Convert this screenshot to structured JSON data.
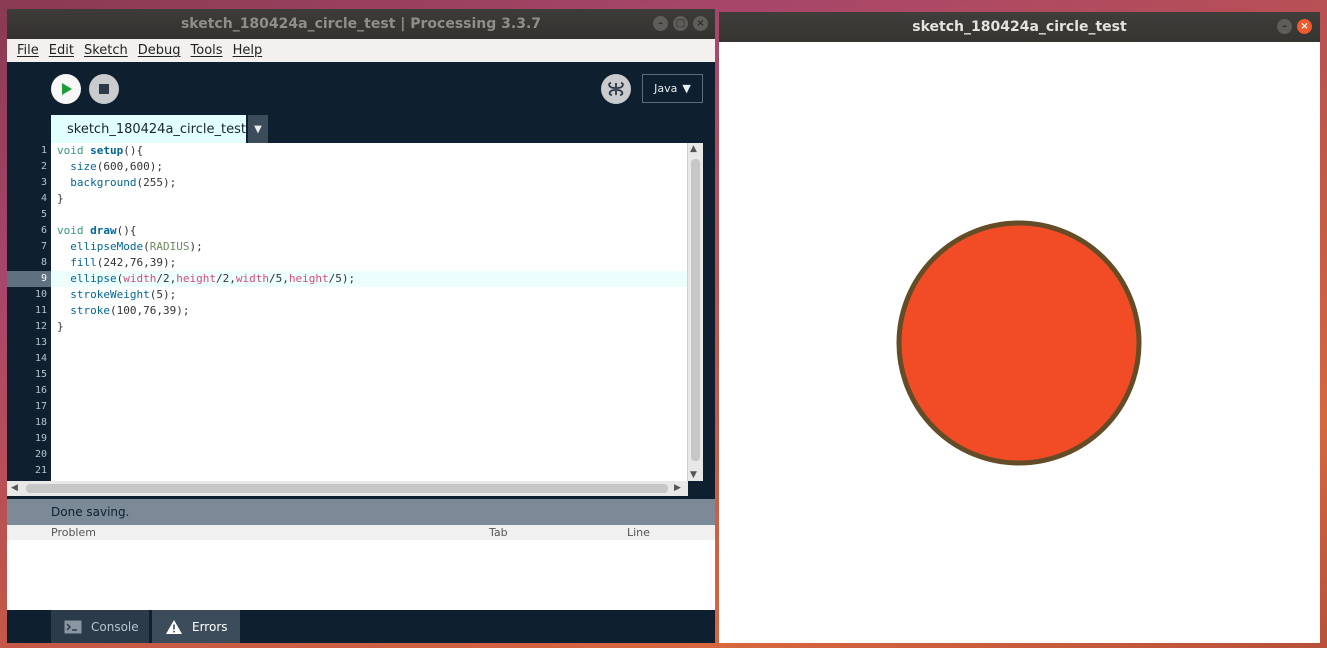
{
  "ide": {
    "title": "sketch_180424a_circle_test | Processing 3.3.7",
    "window_buttons": [
      "minimize",
      "maximize",
      "close"
    ],
    "menu": [
      "File",
      "Edit",
      "Sketch",
      "Debug",
      "Tools",
      "Help"
    ],
    "toolbar": {
      "run_icon": "play-icon",
      "stop_icon": "stop-icon",
      "debug_icon": "butterfly-icon",
      "mode_label": "Java",
      "mode_arrow": "▼"
    },
    "tab": {
      "label": "sketch_180424a_circle_test",
      "menu_arrow": "▼"
    },
    "editor": {
      "line_numbers": [
        "1",
        "2",
        "3",
        "4",
        "5",
        "6",
        "7",
        "8",
        "9",
        "10",
        "11",
        "12",
        "13",
        "14",
        "15",
        "16",
        "17",
        "18",
        "19",
        "20",
        "21"
      ],
      "current_line": 9,
      "lines": [
        "void setup(){",
        "  size(600,600);",
        "  background(255);",
        "}",
        "",
        "void draw(){",
        "  ellipseMode(RADIUS);",
        "  fill(242,76,39);",
        "  ellipse(width/2,height/2,width/5,height/5);",
        "  strokeWeight(5);",
        "  stroke(100,76,39);",
        "}"
      ]
    },
    "status": "Done saving.",
    "problems_table": {
      "columns": [
        "Problem",
        "Tab",
        "Line"
      ],
      "rows": []
    },
    "bottom_tabs": [
      {
        "label": "Console",
        "icon": "console-icon"
      },
      {
        "label": "Errors",
        "icon": "warning-icon"
      }
    ]
  },
  "sketch": {
    "title": "sketch_180424a_circle_test",
    "background": "#ffffff",
    "circle": {
      "fill": "#f24c27",
      "stroke": "#644c27"
    }
  },
  "colors": {
    "ide_bg": "#0e1f30",
    "keyword": "#33997e",
    "function": "#006699",
    "variable": "#d94a7a",
    "constant": "#718a62",
    "accent_tab": "#e0fffd"
  }
}
